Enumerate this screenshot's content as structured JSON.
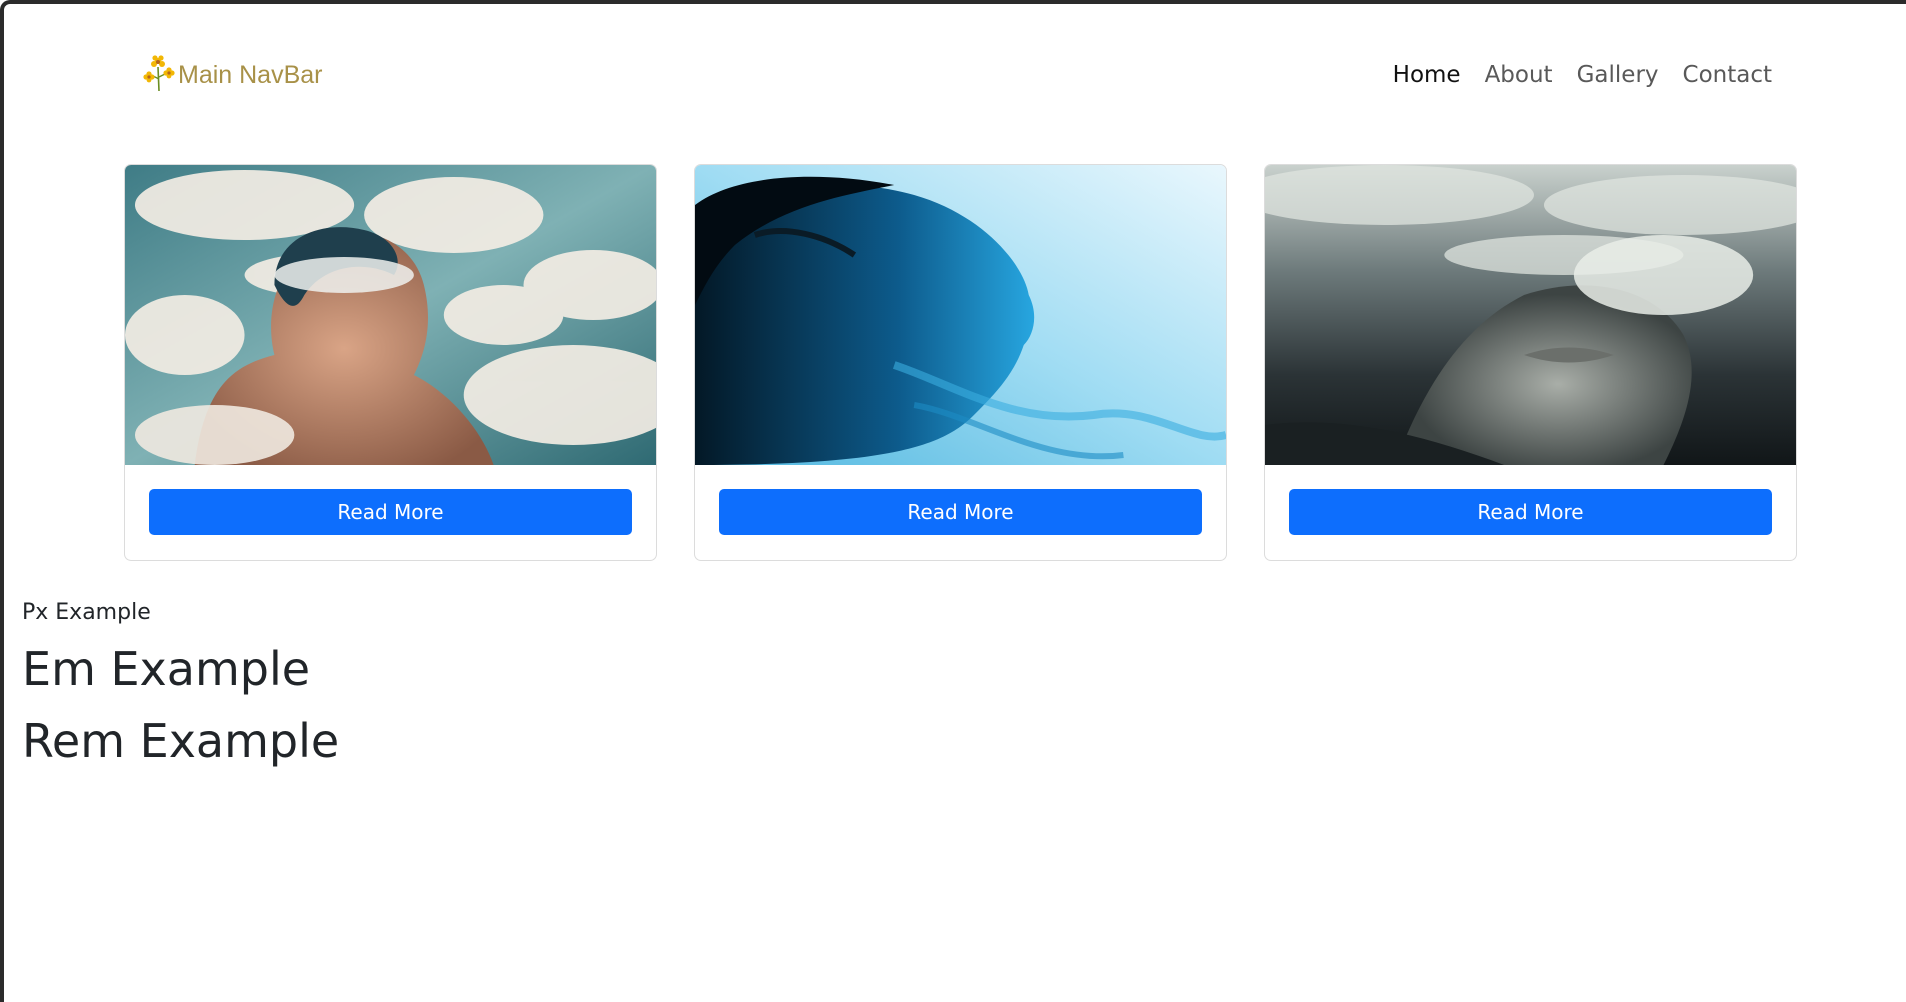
{
  "navbar": {
    "brand_label": "Main NavBar",
    "brand_icon": "flower-logo-icon",
    "links": [
      {
        "label": "Home",
        "active": true
      },
      {
        "label": "About",
        "active": false
      },
      {
        "label": "Gallery",
        "active": false
      },
      {
        "label": "Contact",
        "active": false
      }
    ]
  },
  "cards": [
    {
      "image": "woman-clouds-portrait",
      "button_label": "Read More"
    },
    {
      "image": "woman-blue-smoke-profile",
      "button_label": "Read More"
    },
    {
      "image": "woman-stormy-sky-face",
      "button_label": "Read More"
    }
  ],
  "examples": {
    "px": "Px Example",
    "em": "Em Example",
    "rem": "Rem Example"
  },
  "colors": {
    "primary_button": "#0d6efd",
    "brand_text": "#a89148",
    "nav_link": "#595959",
    "nav_link_active": "#111111",
    "text": "#212529"
  }
}
